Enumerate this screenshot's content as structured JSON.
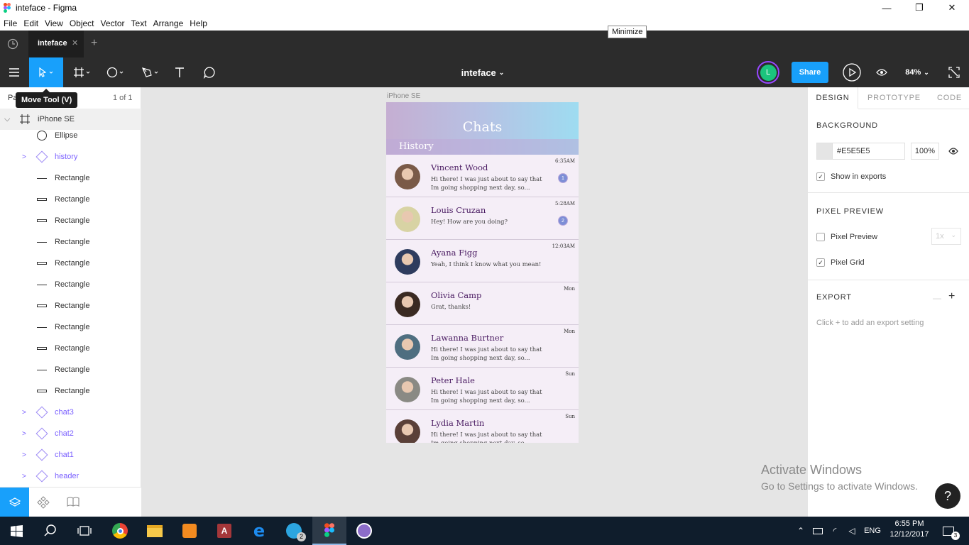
{
  "window": {
    "title": "inteface - Figma",
    "min_icon": "minimize-icon",
    "max_icon": "restore-icon",
    "close_icon": "close-icon",
    "tooltip": "Minimize"
  },
  "menu": [
    "File",
    "Edit",
    "View",
    "Object",
    "Vector",
    "Text",
    "Arrange",
    "Help"
  ],
  "tabs": {
    "active": "inteface",
    "close": "✕",
    "add": "+"
  },
  "toolbar": {
    "file_name": "inteface",
    "avatar_letter": "L",
    "share_label": "Share",
    "zoom": "84%",
    "move_tool_tip": "Move Tool (V)"
  },
  "left_panel": {
    "pages_label": "Pa",
    "page_count": "1 of 1",
    "frame_name": "iPhone SE",
    "layers": [
      {
        "name": "Ellipse",
        "type": "ellipse"
      },
      {
        "name": "history",
        "type": "component"
      },
      {
        "name": "Rectangle",
        "type": "line"
      },
      {
        "name": "Rectangle",
        "type": "rect"
      },
      {
        "name": "Rectangle",
        "type": "rect"
      },
      {
        "name": "Rectangle",
        "type": "line"
      },
      {
        "name": "Rectangle",
        "type": "rect"
      },
      {
        "name": "Rectangle",
        "type": "line"
      },
      {
        "name": "Rectangle",
        "type": "rect"
      },
      {
        "name": "Rectangle",
        "type": "line"
      },
      {
        "name": "Rectangle",
        "type": "rect"
      },
      {
        "name": "Rectangle",
        "type": "line"
      },
      {
        "name": "Rectangle",
        "type": "rect"
      },
      {
        "name": "chat3",
        "type": "component"
      },
      {
        "name": "chat2",
        "type": "component"
      },
      {
        "name": "chat1",
        "type": "component"
      },
      {
        "name": "header",
        "type": "component"
      }
    ]
  },
  "canvas": {
    "frame_label": "iPhone SE",
    "header_title": "Chats",
    "history_label": "History",
    "chats": [
      {
        "name": "Vincent Wood",
        "msg1": "Hi there! I was just about to say that",
        "msg2": "Im going shopping next day, so...",
        "time": "6:35AM",
        "badge": "1",
        "avatar": "#7a5a48"
      },
      {
        "name": "Louis Cruzan",
        "msg1": "Hey! How are you doing?",
        "msg2": "",
        "time": "5:28AM",
        "badge": "2",
        "avatar": "#d8d3a4"
      },
      {
        "name": "Ayana Figg",
        "msg1": "Yeah, I think I know what you mean!",
        "msg2": "",
        "time": "12:03AM",
        "badge": "",
        "avatar": "#2e3c5e"
      },
      {
        "name": "Olivia Camp",
        "msg1": "Grat, thanks!",
        "msg2": "",
        "time": "Mon",
        "badge": "",
        "avatar": "#3a2a22"
      },
      {
        "name": "Lawanna Burtner",
        "msg1": "Hi there! I was just about to say that",
        "msg2": "Im going shopping next day, so...",
        "time": "Mon",
        "badge": "",
        "avatar": "#4e6e80"
      },
      {
        "name": "Peter Hale",
        "msg1": "Hi there! I was just about to say that",
        "msg2": "Im going shopping next day, so...",
        "time": "Sun",
        "badge": "",
        "avatar": "#8a8a84"
      },
      {
        "name": "Lydia Martin",
        "msg1": "Hi there! I was just about to say that",
        "msg2": "Im going shopping next day, so...",
        "time": "Sun",
        "badge": "",
        "avatar": "#5a4038"
      }
    ]
  },
  "right_panel": {
    "tabs": [
      "DESIGN",
      "PROTOTYPE",
      "CODE"
    ],
    "background_h": "BACKGROUND",
    "bg_hex": "#E5E5E5",
    "bg_opacity": "100%",
    "show_exports": "Show in exports",
    "pixel_preview_h": "PIXEL PREVIEW",
    "pixel_preview": "Pixel Preview",
    "scale": "1x",
    "pixel_grid": "Pixel Grid",
    "export_h": "EXPORT",
    "export_hint": "Click + to add an export setting",
    "check": "✓"
  },
  "activate": {
    "title": "Activate Windows",
    "sub": "Go to Settings to activate Windows."
  },
  "help": "?",
  "taskbar": {
    "lang": "ENG",
    "time": "6:55 PM",
    "date": "12/12/2017",
    "notif_count": "3",
    "telegram_badge": "2"
  },
  "colors": {
    "accent": "#18a0fb",
    "dark": "#2c2c2c",
    "component": "#7b61ff",
    "avatar_ring": "#9747ff",
    "avatar_fill": "#1bc47d"
  }
}
